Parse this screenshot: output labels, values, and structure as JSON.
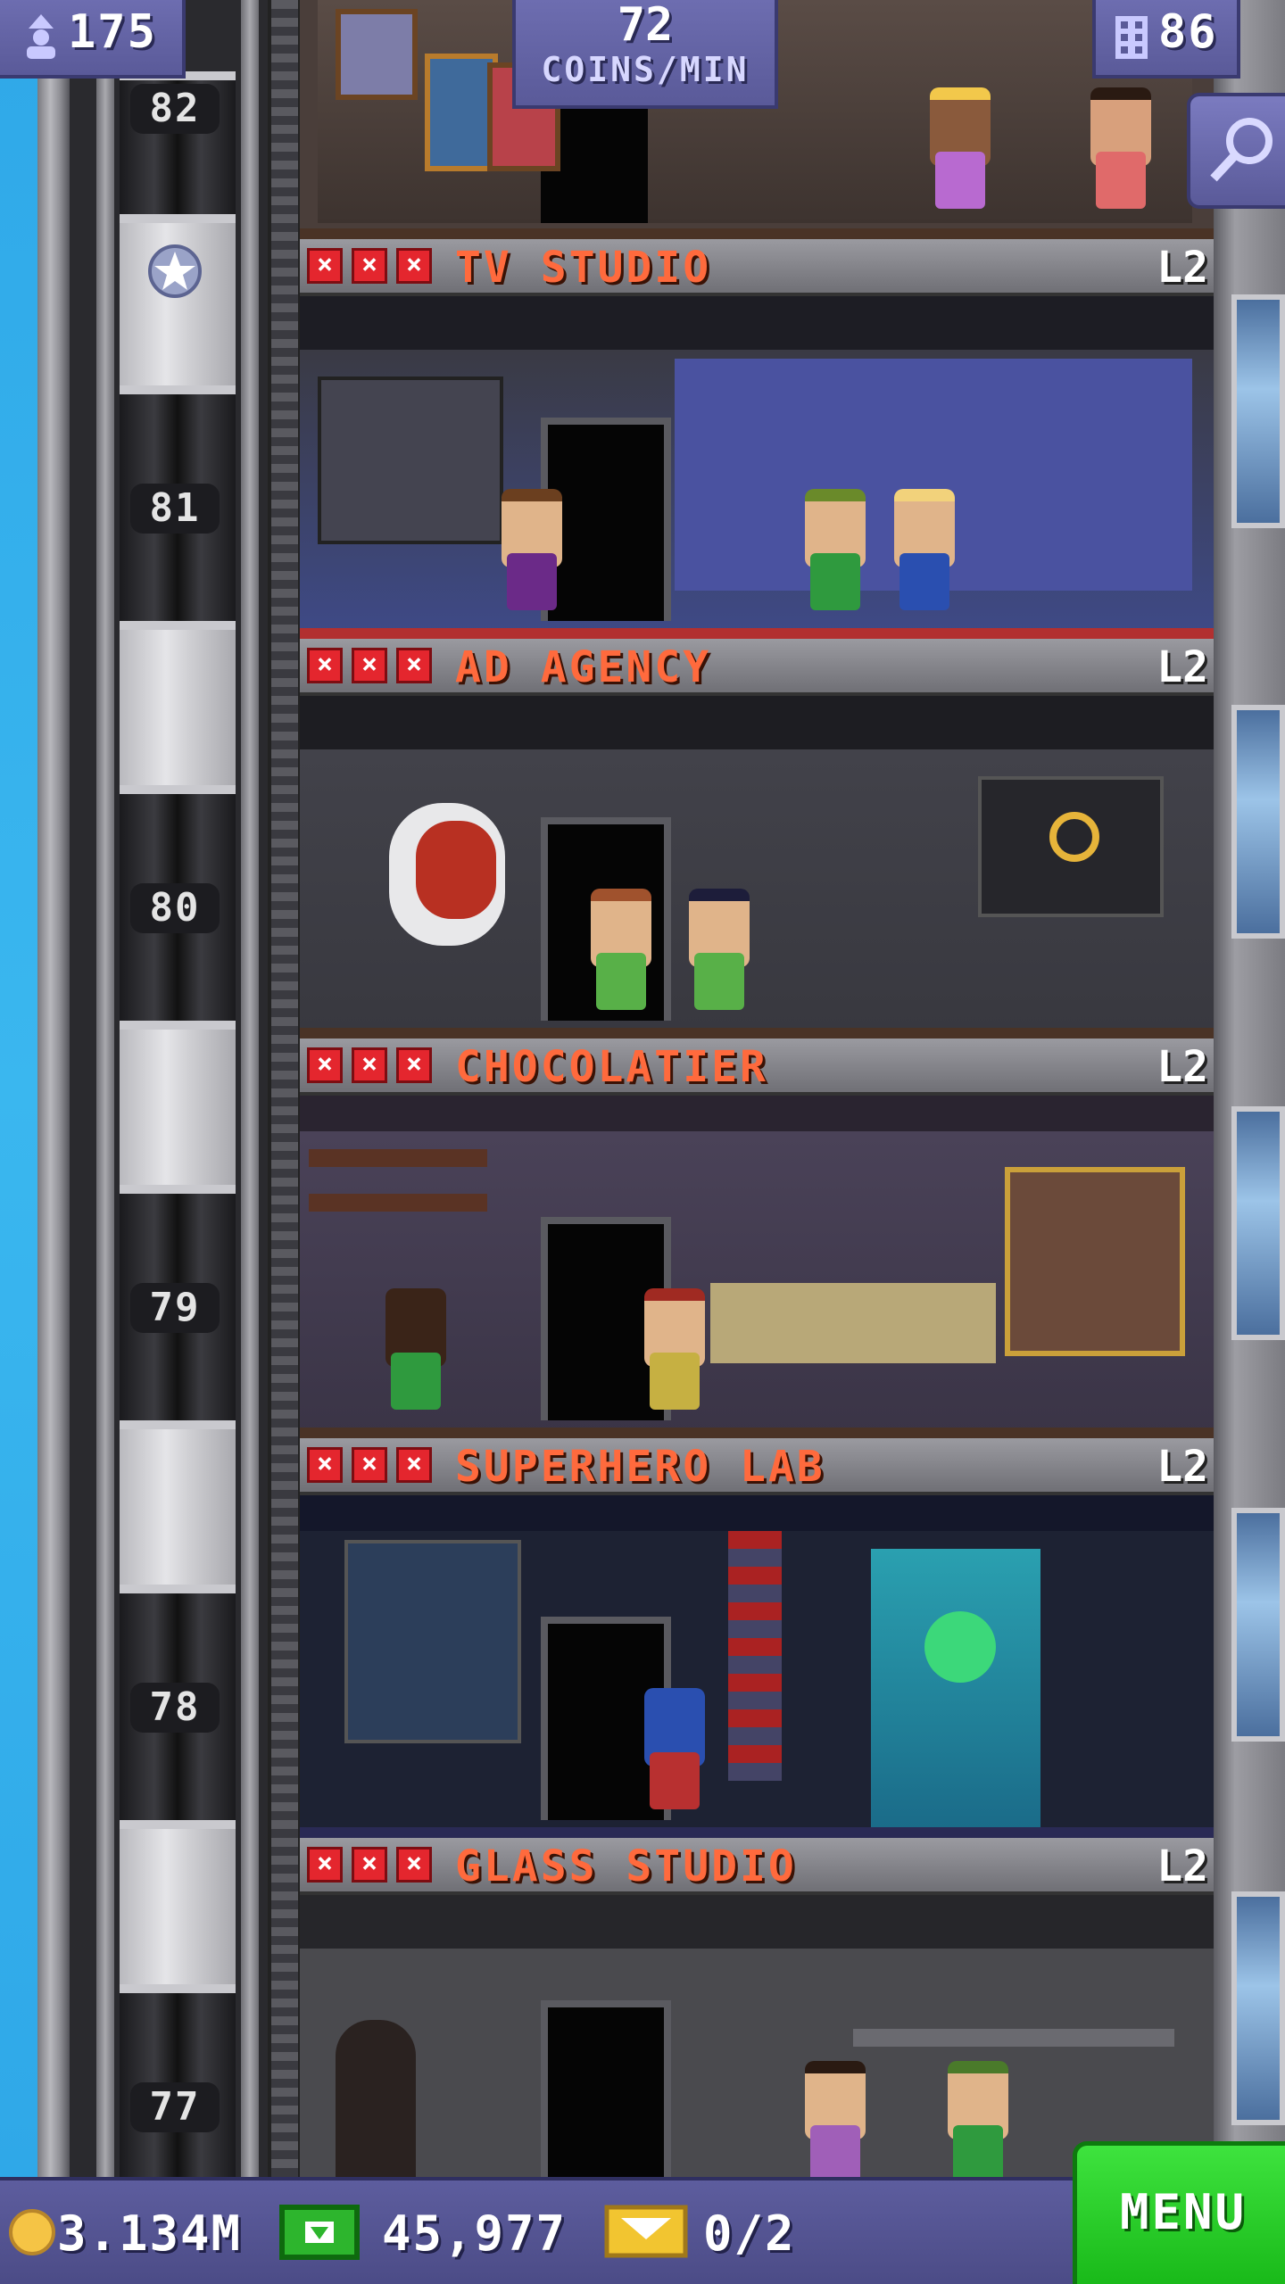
{
  "hud": {
    "population": "175",
    "coins_per_min": "72",
    "coins_per_min_label": "COINS/MIN",
    "floors": "86"
  },
  "elevator": {
    "floors": [
      "82",
      "81",
      "80",
      "79",
      "78",
      "77"
    ]
  },
  "rooms": [
    {
      "name": "TV STUDIO",
      "level": "L2",
      "theme": "#3a3a66"
    },
    {
      "name": "AD AGENCY",
      "level": "L2",
      "theme": "#3c3c42"
    },
    {
      "name": "CHOCOLATIER",
      "level": "L2",
      "theme": "#3e3848"
    },
    {
      "name": "SUPERHERO LAB",
      "level": "L2",
      "theme": "#1d2233"
    },
    {
      "name": "GLASS STUDIO",
      "level": "L2",
      "theme": "#3a3a3e"
    }
  ],
  "bottom_bar": {
    "coins": "3.134M",
    "bux": "45,977",
    "tickets": "0/2",
    "menu_label": "MENU"
  },
  "colors": {
    "room_name": "#ff6a3d",
    "hud_panel": "#5a5a99",
    "menu_green": "#18b818",
    "empty_slot_red": "#e4262e"
  }
}
